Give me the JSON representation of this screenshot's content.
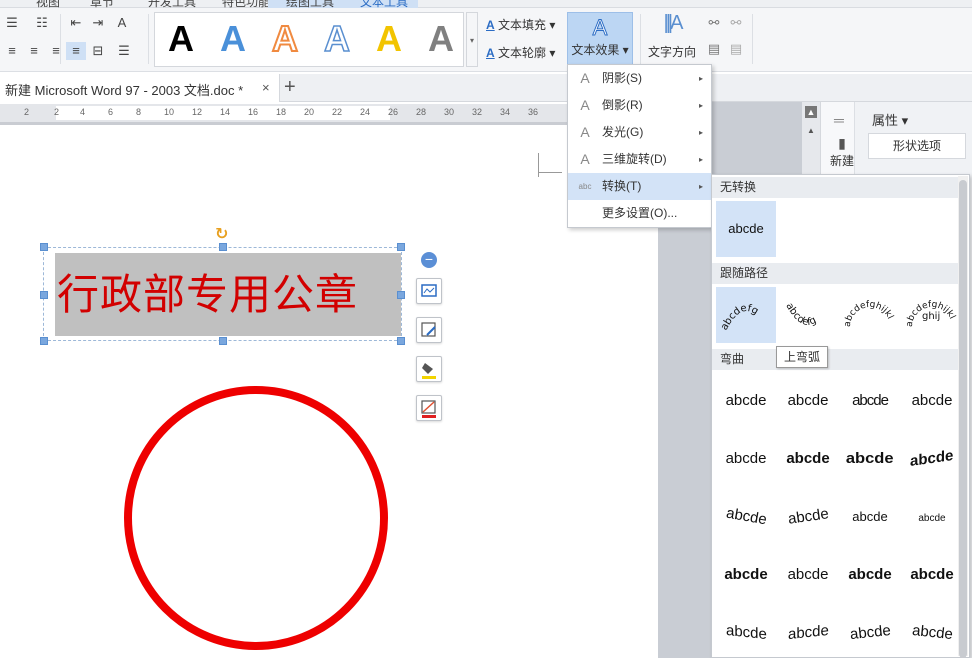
{
  "menu_tabs": {
    "view": "视图",
    "chapter": "章节",
    "dev": "开发工具",
    "special": "特色功能",
    "drawing": "绘图工具",
    "text_tools": "文本工具"
  },
  "ribbon": {
    "wordart_styles": [
      {
        "glyph": "A",
        "color": "#000000"
      },
      {
        "glyph": "A",
        "color": "#4a90d9"
      },
      {
        "glyph": "A",
        "color": "#f0a060"
      },
      {
        "glyph": "A",
        "color": "#ffffff"
      },
      {
        "glyph": "A",
        "color": "#f2c400"
      },
      {
        "glyph": "A",
        "color": "#707070"
      }
    ],
    "text_fill": "文本填充",
    "text_outline": "文本轮廓",
    "text_effect": "文本效果",
    "text_direction": "文字方向"
  },
  "doc_tab": {
    "title": "新建 Microsoft Word 97 - 2003 文档.doc *",
    "close": "×",
    "new": "+"
  },
  "ruler": {
    "numbers": [
      "2",
      "2",
      "4",
      "6",
      "8",
      "10",
      "12",
      "14",
      "16",
      "18",
      "20",
      "22",
      "24",
      "26",
      "28",
      "30",
      "32",
      "34",
      "36"
    ]
  },
  "document": {
    "stamp_text": "行政部专用公章"
  },
  "prop_panel": {
    "title": "属性 ▾",
    "new_label": "新建",
    "shape_options": "形状选项"
  },
  "effect_menu": {
    "items": [
      {
        "icon": "A",
        "label": "阴影(S)",
        "arrow": "▸"
      },
      {
        "icon": "A",
        "label": "倒影(R)",
        "arrow": "▸"
      },
      {
        "icon": "A",
        "label": "发光(G)",
        "arrow": "▸"
      },
      {
        "icon": "A",
        "label": "三维旋转(D)",
        "arrow": "▸"
      },
      {
        "icon": "abc",
        "label": "转换(T)",
        "arrow": "▸"
      },
      {
        "icon": "",
        "label": "更多设置(O)...",
        "arrow": ""
      }
    ]
  },
  "transform_menu": {
    "sections": {
      "none": "无转换",
      "path": "跟随路径",
      "warp": "弯曲"
    },
    "none_sample": "abcde",
    "path_samples": [
      "abcdefg",
      "abcdefg",
      "abcdefghijkl",
      "abcdefghijkl"
    ],
    "warp_rows": [
      [
        "abcde",
        "abcde",
        "abcde",
        "abcde"
      ],
      [
        "abcde",
        "abcde",
        "abcde",
        "abcde"
      ],
      [
        "abcde",
        "abcde",
        "abcde",
        "abcde"
      ],
      [
        "abcde",
        "abcde",
        "abcde",
        "abcde"
      ],
      [
        "abcde",
        "abcde",
        "abcde",
        "abcde"
      ]
    ],
    "tooltip": "上弯弧"
  }
}
